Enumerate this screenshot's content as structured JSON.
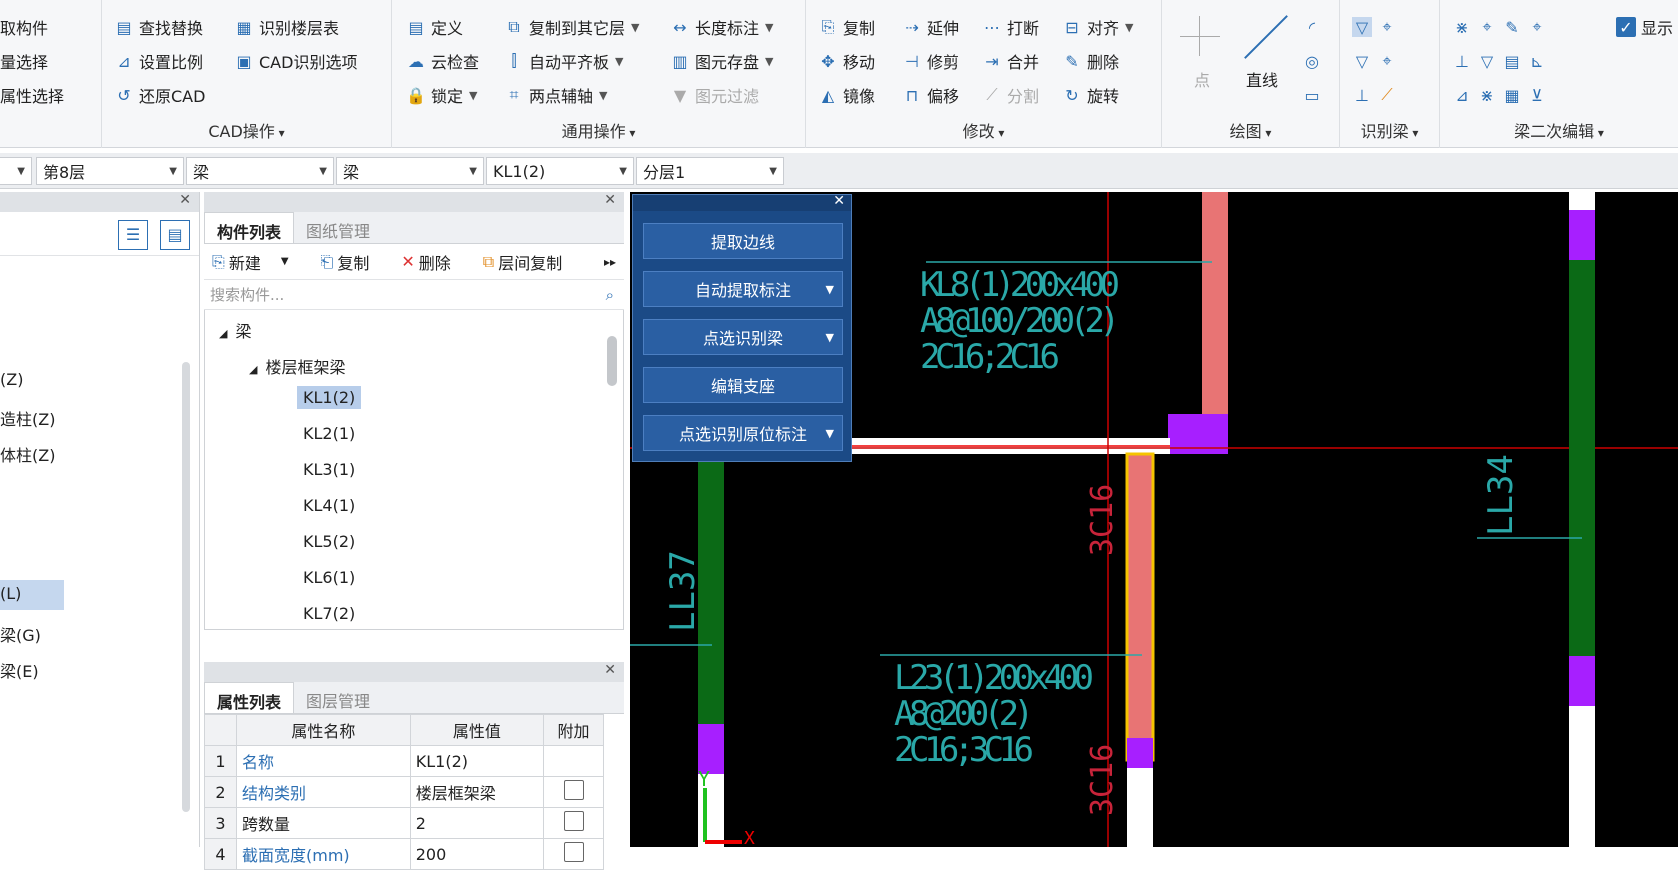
{
  "ribbon": {
    "g0": {
      "items": [
        "拾取构件",
        "批量选择",
        "按属性选择"
      ]
    },
    "cad": {
      "title": "CAD操作",
      "items": [
        "查找替换",
        "识别楼层表",
        "设置比例",
        "CAD识别选项",
        "还原CAD"
      ]
    },
    "common": {
      "title": "通用操作",
      "items": [
        "定义",
        "复制到其它层",
        "长度标注",
        "云检查",
        "自动平齐板",
        "图元存盘",
        "锁定",
        "两点辅轴",
        "图元过滤"
      ]
    },
    "modify": {
      "title": "修改",
      "items": [
        "复制",
        "延伸",
        "打断",
        "对齐",
        "移动",
        "修剪",
        "合并",
        "删除",
        "镜像",
        "偏移",
        "分割",
        "旋转"
      ]
    },
    "draw": {
      "title": "绘图",
      "point": "点",
      "line": "直线"
    },
    "identify": {
      "title": "识别梁"
    },
    "secondary": {
      "title": "梁二次编辑",
      "show": "显示"
    }
  },
  "selectors": {
    "floor": "第8层",
    "type1": "梁",
    "type2": "梁",
    "component": "KL1(2)",
    "layer": "分层1"
  },
  "leftPanel": {
    "items": [
      "(Z)",
      "造柱(Z)",
      "体柱(Z)",
      "(L)",
      "梁(G)",
      "梁(E)"
    ]
  },
  "componentPanel": {
    "tabs": [
      "构件列表",
      "图纸管理"
    ],
    "toolbar": [
      "新建",
      "复制",
      "删除",
      "层间复制"
    ],
    "search_placeholder": "搜索构件...",
    "tree": {
      "root": "梁",
      "group": "楼层框架梁",
      "items": [
        "KL1(2)",
        "KL2(1)",
        "KL3(1)",
        "KL4(1)",
        "KL5(2)",
        "KL6(1)",
        "KL7(2)"
      ]
    }
  },
  "propPanel": {
    "tabs": [
      "属性列表",
      "图层管理"
    ],
    "headers": [
      "属性名称",
      "属性值",
      "附加"
    ],
    "rows": [
      {
        "n": "1",
        "name": "名称",
        "value": "KL1(2)"
      },
      {
        "n": "2",
        "name": "结构类别",
        "value": "楼层框架梁"
      },
      {
        "n": "3",
        "name": "跨数量",
        "value": "2"
      },
      {
        "n": "4",
        "name": "截面宽度(mm)",
        "value": "200"
      }
    ]
  },
  "floatPanel": {
    "buttons": [
      "提取边线",
      "自动提取标注",
      "点选识别梁",
      "编辑支座",
      "点选识别原位标注"
    ]
  },
  "cadText": {
    "kl8": [
      "KL8(1)200x400",
      "A8@100/200(2)",
      "2C16;2C16"
    ],
    "l23": [
      "L23(1)200x400",
      "A8@200(2)",
      "2C16;3C16"
    ],
    "r1": "3C16",
    "r2": "3C16",
    "ll37": "LL37",
    "ll34": "LL34",
    "axisY": "Y",
    "axisX": "X"
  }
}
